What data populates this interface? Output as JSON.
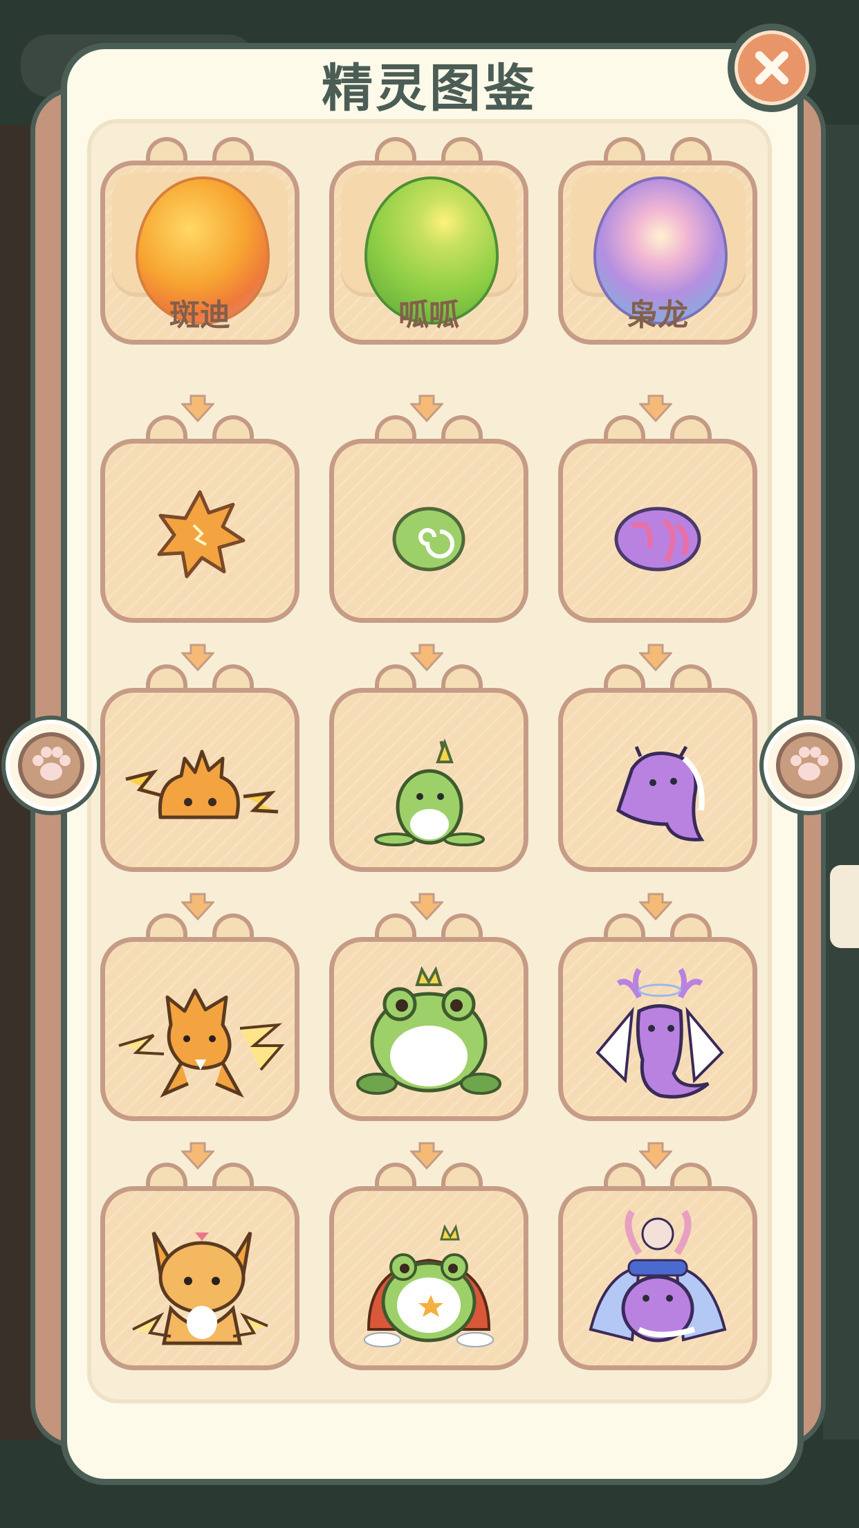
{
  "title": "精灵图鉴",
  "colors": {
    "panel": "#fdfaea",
    "frame": "#4a5e55",
    "card": "#f6dcb4",
    "card_border": "#c69c86",
    "close": "#e8956a"
  },
  "close_icon": "close-icon",
  "paw_icon": "paw-icon",
  "eggs": [
    {
      "name": "斑迪",
      "element": "electric"
    },
    {
      "name": "呱呱",
      "element": "grass"
    },
    {
      "name": "枭龙",
      "element": "mystic"
    }
  ],
  "evolution_rows": [
    [
      "spiky-ball",
      "green-swirl-ball",
      "purple-ball"
    ],
    [
      "spiky-blob",
      "green-sprout",
      "purple-ghost"
    ],
    [
      "electric-cub",
      "crowned-frog",
      "horned-fairy"
    ],
    [
      "electric-fox",
      "royal-frog-king",
      "dragon-queen"
    ]
  ]
}
